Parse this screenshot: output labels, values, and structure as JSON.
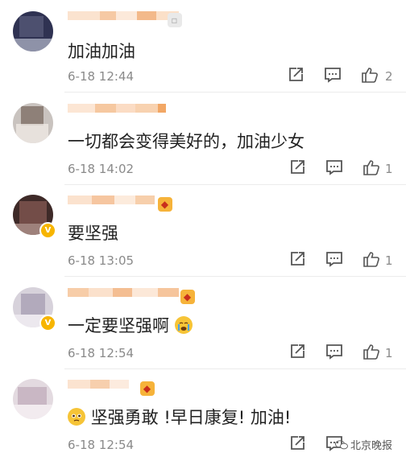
{
  "comments": [
    {
      "username": "▇▇▇▇▇▇▇▇▇▇",
      "text": "加油加油",
      "time": "6-18 12:44",
      "likes": "2",
      "verified": false,
      "avatar_color": "#3b3d5c",
      "badge": false
    },
    {
      "username": "▇▇▇▇▇▇▇▇▇",
      "text": "一切都会变得美好的，加油少女",
      "time": "6-18 14:02",
      "likes": "1",
      "verified": false,
      "avatar_color": "#9a8f86",
      "badge": false
    },
    {
      "username": "▇▇▇▇▇▇▇▇",
      "text": "要坚强",
      "time": "6-18 13:05",
      "likes": "1",
      "verified": true,
      "avatar_color": "#6a4a44",
      "badge": true
    },
    {
      "username": "▇▇▇▇▇▇▇▇▇",
      "text": "一定要坚强啊",
      "time": "6-18 12:54",
      "likes": "1",
      "verified": true,
      "avatar_color": "#b9b1c0",
      "badge": true,
      "emoji": "crying-face"
    },
    {
      "username": "▇▇▇▇▇",
      "text": "坚强勇敢 !早日康复! 加油!",
      "time": "6-18 12:54",
      "likes": "",
      "verified": false,
      "avatar_color": "#d6ccd3",
      "badge": true,
      "emoji_prefix": "pleading-face"
    }
  ],
  "watermark": "北京晚报",
  "colors": {
    "username": "#f08a3a",
    "text": "#222222",
    "meta": "#8a8a8a",
    "verified": "#f7b500"
  }
}
